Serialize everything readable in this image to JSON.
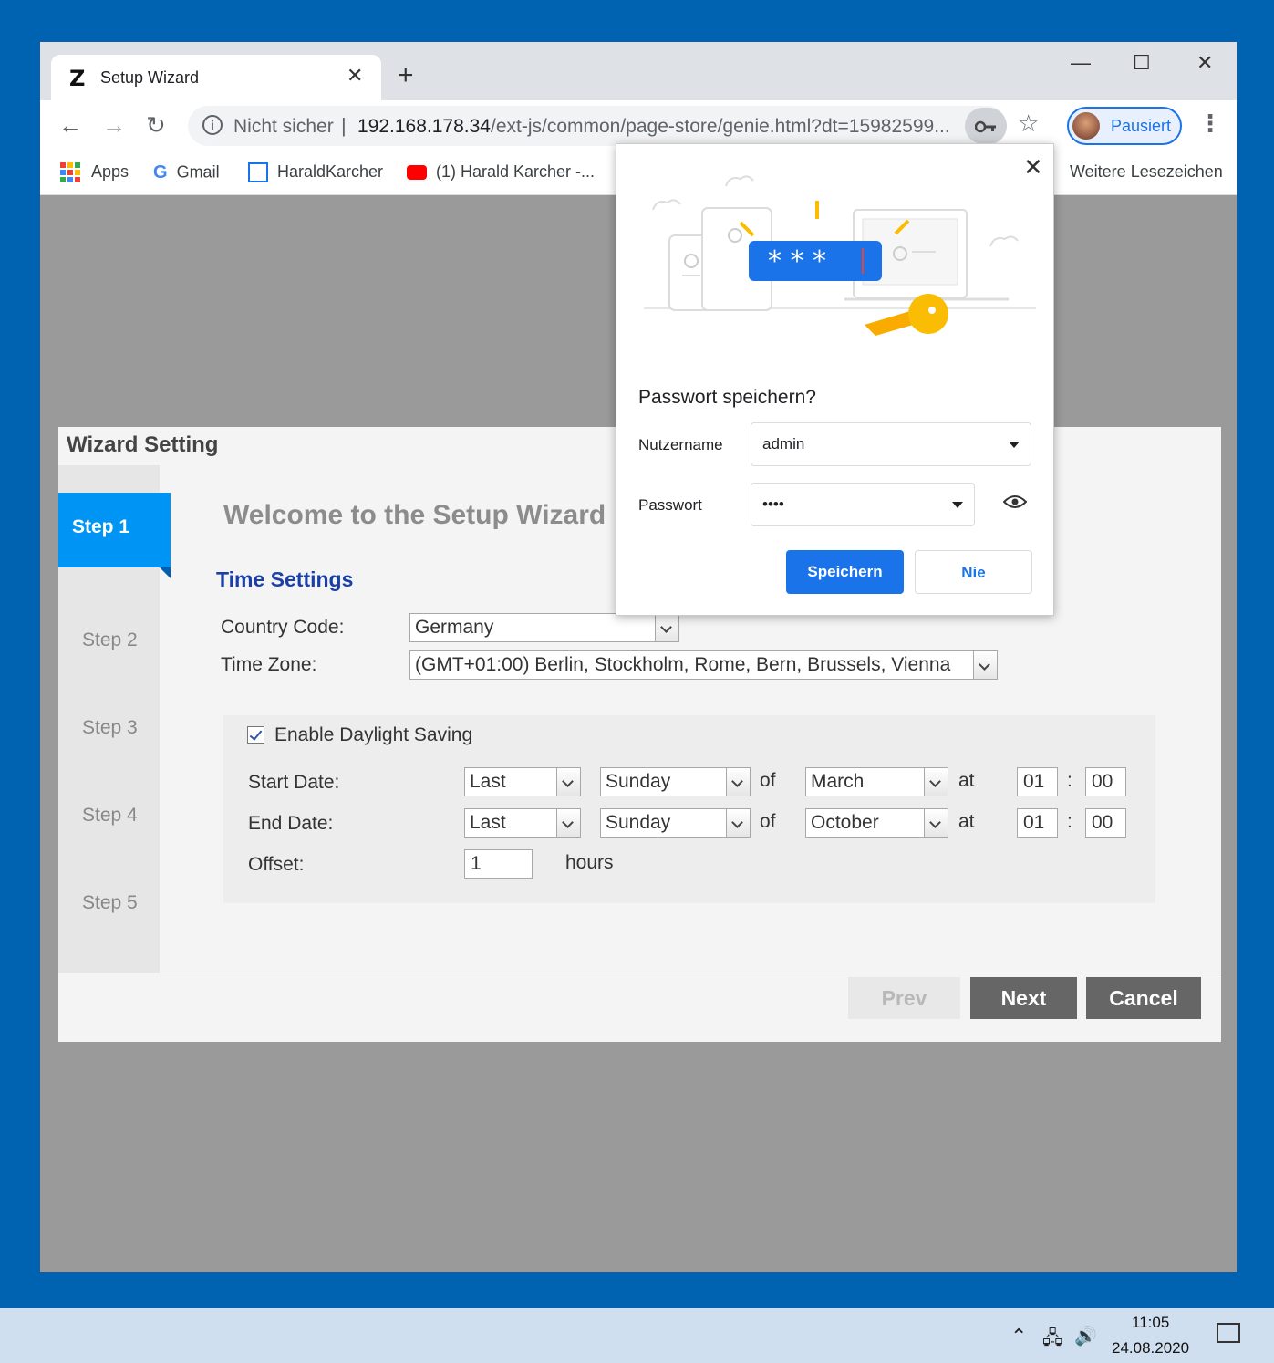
{
  "browser": {
    "tab_favicon": "Z",
    "tab_title": "Setup Wizard",
    "tab_close": "✕",
    "new_tab": "+",
    "minimize": "—",
    "maximize": "☐",
    "close": "✕",
    "not_secure": "Nicht sicher",
    "url_host": "192.168.178.34",
    "url_rest": "/ext-js/common/page-store/genie.html?dt=15982599...",
    "profile_label": "Pausiert",
    "icons": [
      "back-icon",
      "forward-icon",
      "reload-icon",
      "info-icon",
      "key-icon",
      "star-icon",
      "menu-icon"
    ]
  },
  "bookmarks": {
    "apps": "Apps",
    "gmail": "Gmail",
    "harald": "HaraldKarcher",
    "youtube": "(1) Harald Karcher -...",
    "more": "Weitere Lesezeichen"
  },
  "wizard": {
    "title": "Wizard Setting",
    "steps": [
      "Step 1",
      "Step 2",
      "Step 3",
      "Step 4",
      "Step 5"
    ],
    "welcome": "Welcome to the Setup Wizard",
    "section_title": "Time Settings",
    "country_label": "Country Code:",
    "country_value": "Germany",
    "timezone_label": "Time Zone:",
    "timezone_value": "(GMT+01:00) Berlin, Stockholm, Rome, Bern, Brussels, Vienna",
    "dst_label": "Enable Daylight Saving",
    "dst_checked": true,
    "start_label": "Start Date:",
    "end_label": "End Date:",
    "offset_label": "Offset:",
    "start": {
      "week": "Last",
      "day": "Sunday",
      "month": "March",
      "hour": "01",
      "minute": "00"
    },
    "end": {
      "week": "Last",
      "day": "Sunday",
      "month": "October",
      "hour": "01",
      "minute": "00"
    },
    "of_text": "of",
    "at_text": "at",
    "colon": ":",
    "offset_value": "1",
    "hours_text": "hours",
    "prev_label": "Prev",
    "next_label": "Next",
    "cancel_label": "Cancel"
  },
  "password_popup": {
    "title": "Passwort speichern?",
    "username_label": "Nutzername",
    "username_value": "admin",
    "password_label": "Passwort",
    "password_value": "••••",
    "illustration_text": "* * *",
    "save_label": "Speichern",
    "never_label": "Nie",
    "close": "✕"
  },
  "taskbar": {
    "time": "11:05",
    "date": "24.08.2020"
  }
}
